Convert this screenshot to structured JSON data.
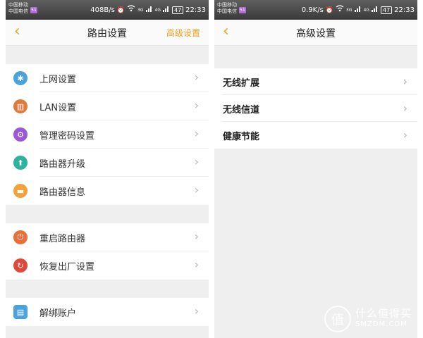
{
  "left_screen": {
    "status": {
      "carrier1": "中国移动",
      "carrier2": "中国电信",
      "sim": "51",
      "speed": "408B/s",
      "net1": "3G",
      "net2": "4G",
      "battery": "47",
      "time": "22:33"
    },
    "nav": {
      "title": "路由设置",
      "action": "高级设置"
    },
    "groups": [
      [
        {
          "label": "上网设置",
          "icon": "gear-icon",
          "color": "#4aa3df"
        },
        {
          "label": "LAN设置",
          "icon": "lan-icon",
          "color": "#e07a3a"
        },
        {
          "label": "管理密码设置",
          "icon": "settings-icon",
          "color": "#9b59d6"
        },
        {
          "label": "路由器升级",
          "icon": "upgrade-icon",
          "color": "#2bb3a0"
        },
        {
          "label": "路由器信息",
          "icon": "router-icon",
          "color": "#f2a23a"
        }
      ],
      [
        {
          "label": "重启路由器",
          "icon": "restart-icon",
          "color": "#e8703a"
        },
        {
          "label": "恢复出厂设置",
          "icon": "reset-icon",
          "color": "#e0483a"
        }
      ],
      [
        {
          "label": "解绑账户",
          "icon": "unbind-icon",
          "color": "#4aa3df"
        }
      ]
    ]
  },
  "right_screen": {
    "status": {
      "carrier1": "中国移动",
      "carrier2": "中国电信",
      "sim": "51",
      "speed": "0.9K/s",
      "net1": "3G",
      "net2": "4G",
      "battery": "47",
      "time": "22:33"
    },
    "nav": {
      "title": "高级设置"
    },
    "items": [
      "无线扩展",
      "无线信道",
      "健康节能"
    ]
  },
  "watermark": {
    "cn": "什么值得买",
    "en": "SMZDM.COM",
    "logo": "值"
  }
}
